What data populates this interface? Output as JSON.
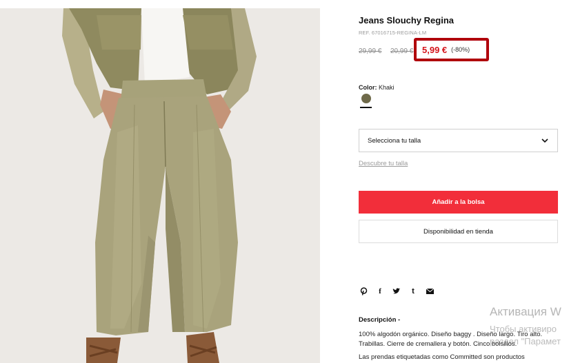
{
  "product": {
    "title": "Jeans Slouchy Regina",
    "ref": "REF. 67016715-REGINA-LM",
    "old_price_1": "29,99 €",
    "old_price_2": "20,99 €",
    "price": "5,99 €",
    "discount": "(-80%)",
    "color_label": "Color:",
    "color_value": "Khaki",
    "swatch_color": "#6f6a4a"
  },
  "size_select": {
    "label": "Selecciona tu talla",
    "icon": "chevron-down-icon"
  },
  "size_guide_link": "Descubre tu talla",
  "buttons": {
    "add_to_bag": "Añadir a la bolsa",
    "store_availability": "Disponibilidad en tienda"
  },
  "share_icons": [
    "pinterest-icon",
    "facebook-icon",
    "twitter-icon",
    "tumblr-icon",
    "email-icon"
  ],
  "description": {
    "title": "Descripción -",
    "text": "100% algodón orgánico. Diseño baggy . Diseño largo. Tiro alto. Trabillas. Cierre de cremallera y botón. Cinco bolsillos.",
    "note": "Las prendas etiquetadas como Committed son productos"
  },
  "watermark": {
    "title": "Активация W",
    "subtitle_1": "Чтобы активиро",
    "subtitle_2": "раздел \"Парамет"
  },
  "colors": {
    "accent_red": "#f22e3a",
    "price_red": "#d4141b",
    "highlight_border": "#b0000b"
  }
}
